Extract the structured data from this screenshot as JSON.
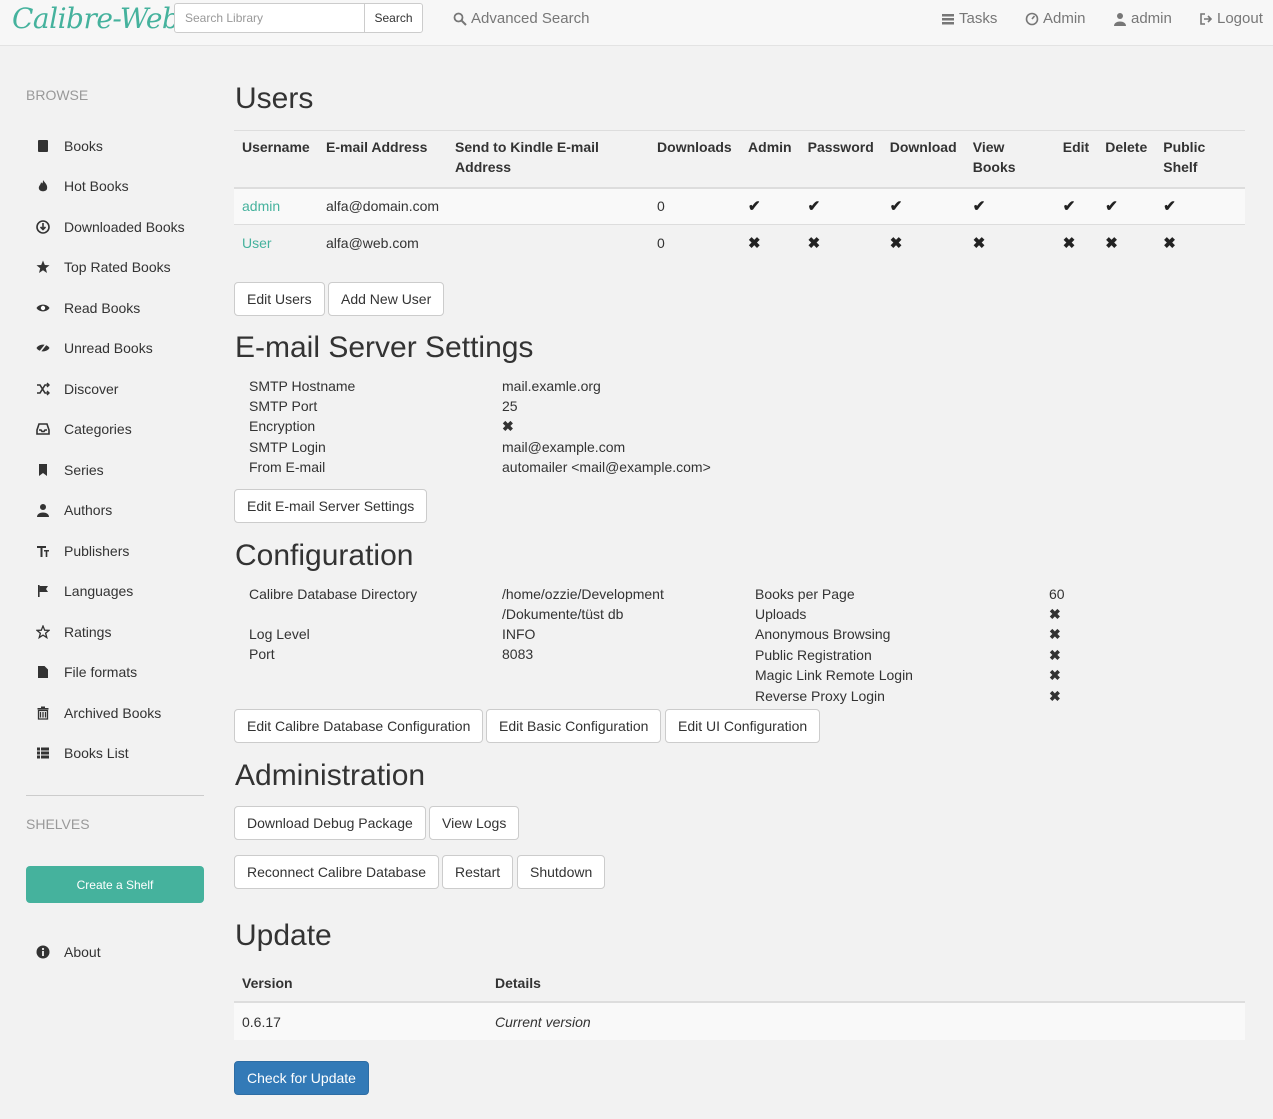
{
  "navbar": {
    "logo": "Calibre-Web",
    "search_placeholder": "Search Library",
    "search_button": "Search",
    "advanced_search": "Advanced Search",
    "tasks": "Tasks",
    "admin": "Admin",
    "user": "admin",
    "logout": "Logout"
  },
  "sidebar": {
    "browse_header": "BROWSE",
    "items": [
      {
        "label": "Books",
        "icon": "book-icon"
      },
      {
        "label": "Hot Books",
        "icon": "fire-icon"
      },
      {
        "label": "Downloaded Books",
        "icon": "download-icon"
      },
      {
        "label": "Top Rated Books",
        "icon": "star-icon"
      },
      {
        "label": "Read Books",
        "icon": "eye-open-icon"
      },
      {
        "label": "Unread Books",
        "icon": "eye-close-icon"
      },
      {
        "label": "Discover",
        "icon": "random-icon"
      },
      {
        "label": "Categories",
        "icon": "inbox-icon"
      },
      {
        "label": "Series",
        "icon": "bookmark-icon"
      },
      {
        "label": "Authors",
        "icon": "user-icon"
      },
      {
        "label": "Publishers",
        "icon": "text-size-icon"
      },
      {
        "label": "Languages",
        "icon": "flag-icon"
      },
      {
        "label": "Ratings",
        "icon": "star-empty-icon"
      },
      {
        "label": "File formats",
        "icon": "file-icon"
      },
      {
        "label": "Archived Books",
        "icon": "trash-icon"
      },
      {
        "label": "Books List",
        "icon": "th-list-icon"
      }
    ],
    "shelves_header": "SHELVES",
    "create_shelf": "Create a Shelf",
    "about": "About"
  },
  "users": {
    "title": "Users",
    "headers": [
      "Username",
      "E-mail Address",
      "Send to Kindle E-mail Address",
      "Downloads",
      "Admin",
      "Password",
      "Download",
      "View Books",
      "Edit",
      "Delete",
      "Public Shelf"
    ],
    "rows": [
      {
        "username": "admin",
        "email": "alfa@domain.com",
        "kindle": "",
        "downloads": "0",
        "flags": [
          "✔",
          "✔",
          "✔",
          "✔",
          "✔",
          "✔",
          "✔"
        ]
      },
      {
        "username": "User",
        "email": "alfa@web.com",
        "kindle": "",
        "downloads": "0",
        "flags": [
          "✖",
          "✖",
          "✖",
          "✖",
          "✖",
          "✖",
          "✖"
        ]
      }
    ],
    "edit_users": "Edit Users",
    "add_user": "Add New User"
  },
  "email": {
    "title": "E-mail Server Settings",
    "rows": [
      {
        "label": "SMTP Hostname",
        "value": "mail.examle.org"
      },
      {
        "label": "SMTP Port",
        "value": "25"
      },
      {
        "label": "Encryption",
        "value": "✖"
      },
      {
        "label": "SMTP Login",
        "value": "mail@example.com"
      },
      {
        "label": "From E-mail",
        "value": "automailer <mail@example.com>"
      }
    ],
    "edit_button": "Edit E-mail Server Settings"
  },
  "config": {
    "title": "Configuration",
    "left": [
      {
        "label": "Calibre Database Directory",
        "value": "/home/ozzie/Development",
        "value2": "/Dokumente/tüst db"
      },
      {
        "label": "Log Level",
        "value": "INFO"
      },
      {
        "label": "Port",
        "value": "8083"
      }
    ],
    "right": [
      {
        "label": "Books per Page",
        "value": "60"
      },
      {
        "label": "Uploads",
        "value": "✖"
      },
      {
        "label": "Anonymous Browsing",
        "value": "✖"
      },
      {
        "label": "Public Registration",
        "value": "✖"
      },
      {
        "label": "Magic Link Remote Login",
        "value": "✖"
      },
      {
        "label": "Reverse Proxy Login",
        "value": "✖"
      }
    ],
    "edit_db": "Edit Calibre Database Configuration",
    "edit_basic": "Edit Basic Configuration",
    "edit_ui": "Edit UI Configuration"
  },
  "administration": {
    "title": "Administration",
    "debug": "Download Debug Package",
    "logs": "View Logs",
    "reconnect": "Reconnect Calibre Database",
    "restart": "Restart",
    "shutdown": "Shutdown"
  },
  "update": {
    "title": "Update",
    "col_version": "Version",
    "col_details": "Details",
    "version": "0.6.17",
    "details": "Current version",
    "check": "Check for Update"
  },
  "colors": {
    "accent": "#45b29d",
    "primary": "#337ab7"
  }
}
